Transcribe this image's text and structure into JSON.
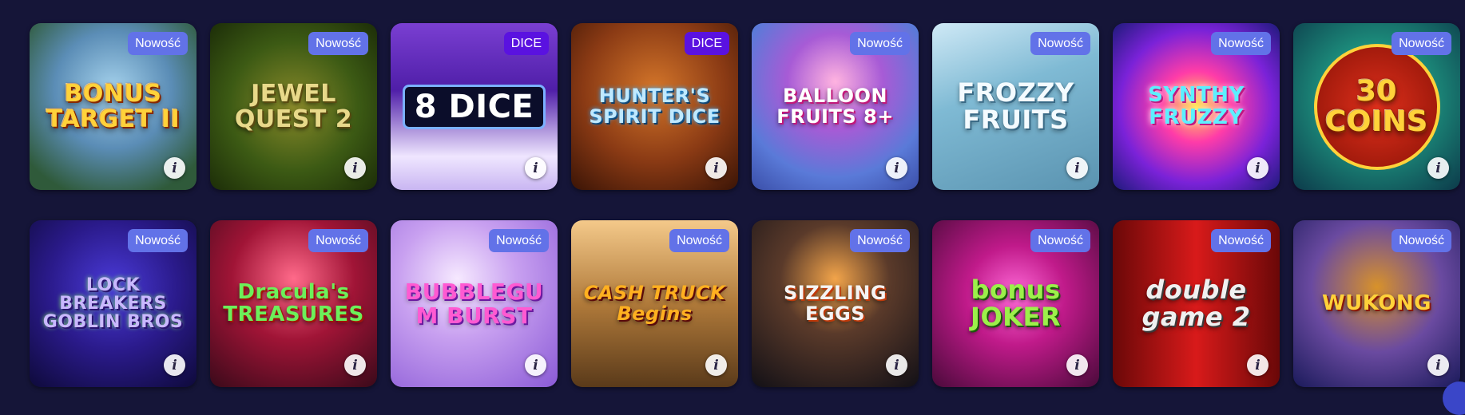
{
  "colors": {
    "background": "#151538",
    "badge_new": "#6272e8",
    "badge_dice": "#5a12e0"
  },
  "games": [
    {
      "title": "BONUS TARGET II",
      "badge": "Nowość"
    },
    {
      "title": "JEWEL QUEST 2",
      "badge": "Nowość"
    },
    {
      "title": "8 DICE",
      "badge": "DICE"
    },
    {
      "title": "HUNTER'S SPIRIT DICE",
      "badge": "DICE"
    },
    {
      "title": "BALLOON FRUITS 8+",
      "badge": "Nowość"
    },
    {
      "title": "FROZZY FRUITS",
      "badge": "Nowość"
    },
    {
      "title": "SYNTHY FRUZZY",
      "badge": "Nowość"
    },
    {
      "title": "30 COINS",
      "badge": "Nowość"
    },
    {
      "title": "LOCK BREAKERS GOBLIN BROS",
      "badge": "Nowość"
    },
    {
      "title": "Dracula's TREASURES",
      "badge": "Nowość"
    },
    {
      "title": "BUBBLEGUM BURST",
      "badge": "Nowość"
    },
    {
      "title": "CASH TRUCK Begins",
      "badge": "Nowość"
    },
    {
      "title": "SIZZLING EGGS",
      "badge": "Nowość"
    },
    {
      "title": "bonus JOKER",
      "badge": "Nowość"
    },
    {
      "title": "double game 2",
      "badge": "Nowość"
    },
    {
      "title": "WUKONG",
      "badge": "Nowość"
    }
  ],
  "info_icon_glyph": "i"
}
